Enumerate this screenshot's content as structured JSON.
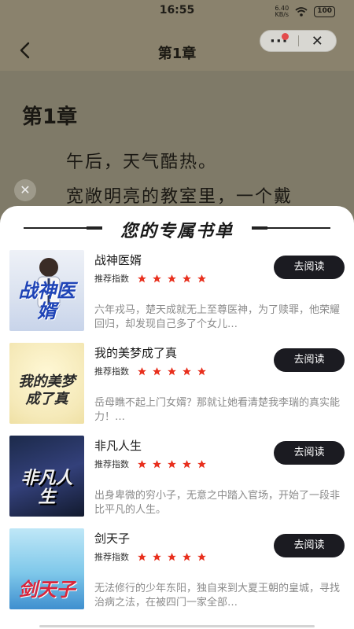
{
  "status_bar": {
    "time": "16:55",
    "net_speed_value": "6.40",
    "net_speed_unit": "KB/s",
    "battery": "100"
  },
  "reader": {
    "header_title": "第1章",
    "chapter_heading": "第1章",
    "paragraph_1": "午后，天气酷热。",
    "paragraph_2": "宽敞明亮的教室里，一个戴",
    "capsule_more": "···",
    "capsule_close": "✕"
  },
  "sheet": {
    "title": "您的专属书单",
    "recommend_label": "推荐指数",
    "read_button_label": "去阅读",
    "star_color": "#e8301e",
    "books": [
      {
        "title": "战神医婿",
        "cover_text": "战神医婿",
        "stars": 5,
        "description": "六年戎马，楚天成就无上至尊医神，为了赎罪，他荣耀回归，却发现自己多了个女儿…"
      },
      {
        "title": "我的美梦成了真",
        "cover_text": "我的美梦成了真",
        "stars": 5,
        "description": "岳母瞧不起上门女婿？那就让她看清楚我李瑞的真实能力！…"
      },
      {
        "title": "非凡人生",
        "cover_text": "非凡人生",
        "stars": 5,
        "description": "出身卑微的穷小子，无意之中踏入官场，开始了一段非比平凡的人生。"
      },
      {
        "title": "剑天子",
        "cover_text": "剑天子",
        "stars": 5,
        "description": "无法修行的少年东阳，独自来到大夏王朝的皇城，寻找治病之法，在被四门一家全部…"
      }
    ]
  }
}
